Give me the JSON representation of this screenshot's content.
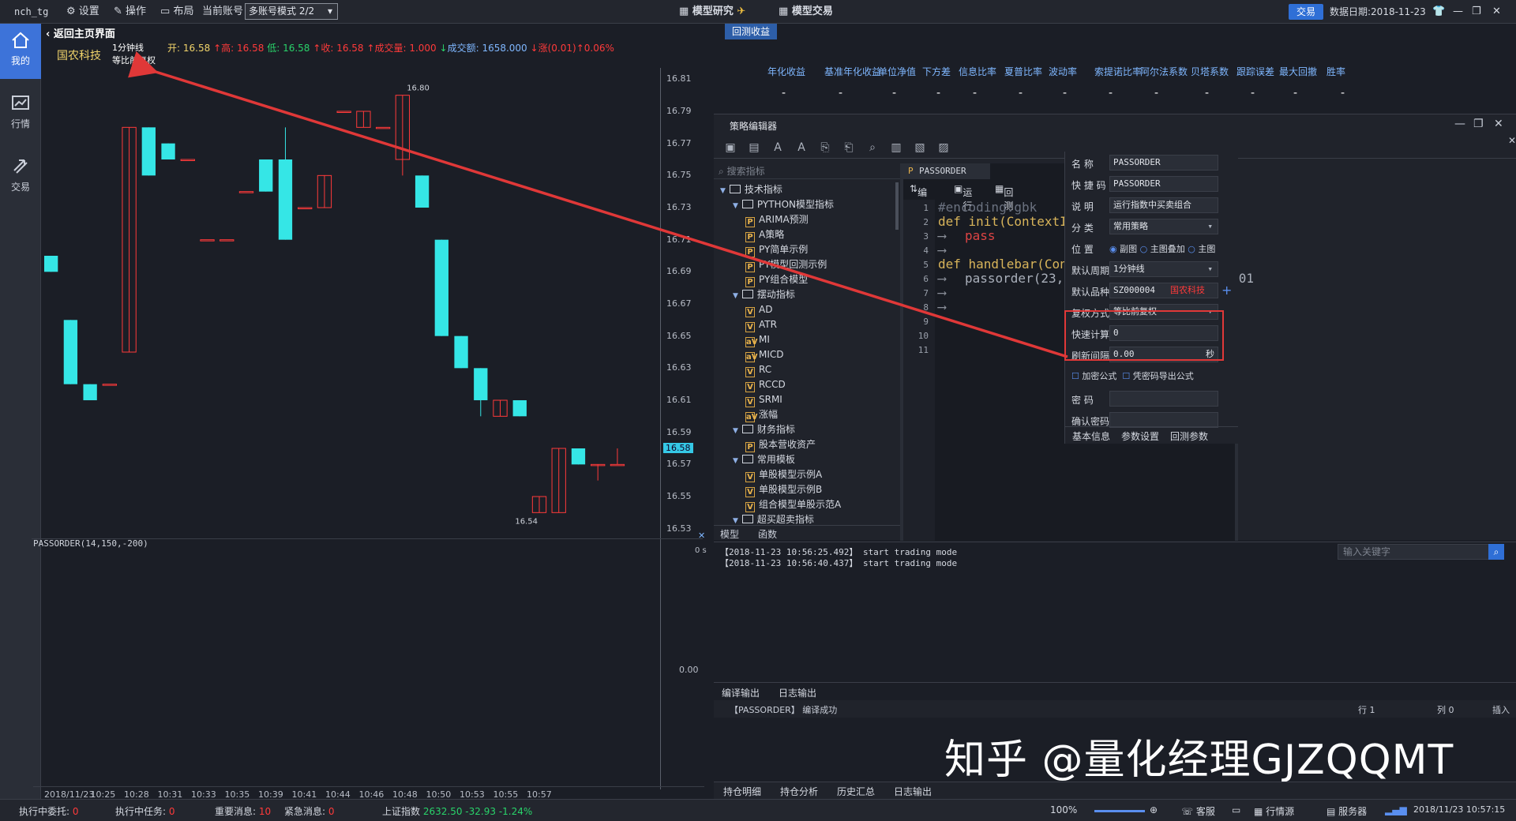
{
  "topbar": {
    "user": "nch_tg",
    "settings": "设置",
    "operate": "操作",
    "layout": "布局",
    "current_account": "当前账号",
    "mode": "多账号模式 2/2",
    "model_research": "模型研究",
    "model_trade": "模型交易",
    "trade": "交易",
    "data_date": "数据日期:2018-11-23"
  },
  "leftnav": {
    "items": [
      {
        "label": "我的"
      },
      {
        "label": "行情"
      },
      {
        "label": "交易"
      }
    ]
  },
  "chart": {
    "back": "返回主页界面",
    "stock": "国农科技",
    "period": "1分钟线",
    "adjust": "等比前复权",
    "quote": {
      "open_label": "开:",
      "open": "16.58",
      "high_label": "高:",
      "high": "16.58",
      "low_label": "低:",
      "low": "16.58",
      "close_label": "收:",
      "close": "16.58",
      "vol_label": "成交量:",
      "vol": "1.000",
      "amt_label": "成交额:",
      "amt": "1658.000",
      "chg_label": "涨(0.01)",
      "chg": "0.06%"
    },
    "high_marker": "16.80",
    "low_marker": "16.54",
    "last_price": "16.58",
    "sub_indicator": "PASSORDER(14,150,-200)",
    "sub_zero": "0.00",
    "sub_right": "0 s"
  },
  "chart_data": {
    "type": "candlestick",
    "yticks": [
      "16.81",
      "16.79",
      "16.77",
      "16.75",
      "16.73",
      "16.71",
      "16.69",
      "16.67",
      "16.65",
      "16.63",
      "16.61",
      "16.59",
      "16.57",
      "16.55",
      "16.53"
    ],
    "xticks": [
      "2018/11/23",
      "10:25",
      "10:28",
      "10:31",
      "10:33",
      "10:35",
      "10:39",
      "10:41",
      "10:44",
      "10:46",
      "10:48",
      "10:50",
      "10:53",
      "10:55",
      "10:57"
    ],
    "candles": [
      {
        "o": 16.7,
        "c": 16.69,
        "h": 16.7,
        "l": 16.69
      },
      {
        "o": 16.66,
        "c": 16.62,
        "h": 16.66,
        "l": 16.62
      },
      {
        "o": 16.62,
        "c": 16.61,
        "h": 16.62,
        "l": 16.61
      },
      {
        "o": 16.62,
        "c": 16.62,
        "h": 16.62,
        "l": 16.62
      },
      {
        "o": 16.64,
        "c": 16.78,
        "h": 16.78,
        "l": 16.64
      },
      {
        "o": 16.78,
        "c": 16.75,
        "h": 16.78,
        "l": 16.75
      },
      {
        "o": 16.77,
        "c": 16.76,
        "h": 16.77,
        "l": 16.76
      },
      {
        "o": 16.76,
        "c": 16.76,
        "h": 16.76,
        "l": 16.76
      },
      {
        "o": 16.71,
        "c": 16.71,
        "h": 16.71,
        "l": 16.71
      },
      {
        "o": 16.71,
        "c": 16.71,
        "h": 16.71,
        "l": 16.71
      },
      {
        "o": 16.74,
        "c": 16.74,
        "h": 16.74,
        "l": 16.74
      },
      {
        "o": 16.76,
        "c": 16.74,
        "h": 16.76,
        "l": 16.74
      },
      {
        "o": 16.76,
        "c": 16.71,
        "h": 16.78,
        "l": 16.71
      },
      {
        "o": 16.73,
        "c": 16.73,
        "h": 16.73,
        "l": 16.73
      },
      {
        "o": 16.73,
        "c": 16.75,
        "h": 16.75,
        "l": 16.73
      },
      {
        "o": 16.79,
        "c": 16.79,
        "h": 16.79,
        "l": 16.79
      },
      {
        "o": 16.78,
        "c": 16.79,
        "h": 16.79,
        "l": 16.78
      },
      {
        "o": 16.78,
        "c": 16.78,
        "h": 16.78,
        "l": 16.78
      },
      {
        "o": 16.76,
        "c": 16.8,
        "h": 16.8,
        "l": 16.75
      },
      {
        "o": 16.75,
        "c": 16.73,
        "h": 16.75,
        "l": 16.73
      },
      {
        "o": 16.71,
        "c": 16.65,
        "h": 16.71,
        "l": 16.65
      },
      {
        "o": 16.65,
        "c": 16.63,
        "h": 16.65,
        "l": 16.63
      },
      {
        "o": 16.63,
        "c": 16.61,
        "h": 16.63,
        "l": 16.6
      },
      {
        "o": 16.6,
        "c": 16.61,
        "h": 16.61,
        "l": 16.6
      },
      {
        "o": 16.61,
        "c": 16.6,
        "h": 16.61,
        "l": 16.6
      },
      {
        "o": 16.54,
        "c": 16.55,
        "h": 16.55,
        "l": 16.54
      },
      {
        "o": 16.54,
        "c": 16.58,
        "h": 16.58,
        "l": 16.54
      },
      {
        "o": 16.58,
        "c": 16.57,
        "h": 16.58,
        "l": 16.57
      },
      {
        "o": 16.57,
        "c": 16.57,
        "h": 16.57,
        "l": 16.56
      },
      {
        "o": 16.57,
        "c": 16.57,
        "h": 16.58,
        "l": 16.57
      }
    ],
    "ylim": [
      16.52,
      16.82
    ]
  },
  "perf": {
    "tab": "回测收益",
    "metrics": [
      "年化收益",
      "基准年化收益",
      "单位净值",
      "下方差",
      "信息比率",
      "夏普比率",
      "波动率",
      "索提诺比率",
      "阿尔法系数",
      "贝塔系数",
      "跟踪误差",
      "最大回撤",
      "胜率"
    ],
    "value": "-"
  },
  "editor": {
    "title": "策略编辑器",
    "search_placeholder": "搜索指标",
    "tree": [
      {
        "t": "folder",
        "label": "技术指标",
        "lvl": 0
      },
      {
        "t": "folder",
        "label": "PYTHON模型指标",
        "lvl": 1
      },
      {
        "t": "P",
        "label": "ARIMA预测",
        "lvl": 2
      },
      {
        "t": "P",
        "label": "A策略",
        "lvl": 2
      },
      {
        "t": "P",
        "label": "PY简单示例",
        "lvl": 2
      },
      {
        "t": "P",
        "label": "PY模型回测示例",
        "lvl": 2
      },
      {
        "t": "P",
        "label": "PY组合模型",
        "lvl": 2
      },
      {
        "t": "folder",
        "label": "摆动指标",
        "lvl": 1
      },
      {
        "t": "V",
        "label": "AD",
        "lvl": 2
      },
      {
        "t": "V",
        "label": "ATR",
        "lvl": 2
      },
      {
        "t": "aV",
        "label": "MI",
        "lvl": 2
      },
      {
        "t": "aV",
        "label": "MICD",
        "lvl": 2
      },
      {
        "t": "V",
        "label": "RC",
        "lvl": 2
      },
      {
        "t": "V",
        "label": "RCCD",
        "lvl": 2
      },
      {
        "t": "V",
        "label": "SRMI",
        "lvl": 2
      },
      {
        "t": "aV",
        "label": "涨幅",
        "lvl": 2
      },
      {
        "t": "folder",
        "label": "财务指标",
        "lvl": 1
      },
      {
        "t": "P",
        "label": "股本营收资产",
        "lvl": 2
      },
      {
        "t": "folder",
        "label": "常用模板",
        "lvl": 1
      },
      {
        "t": "V",
        "label": "单股模型示例A",
        "lvl": 2
      },
      {
        "t": "V",
        "label": "单股模型示例B",
        "lvl": 2
      },
      {
        "t": "V",
        "label": "组合模型单股示范A",
        "lvl": 2
      },
      {
        "t": "folder",
        "label": "超买超卖指标",
        "lvl": 1
      }
    ],
    "tree_tabs": [
      "模型",
      "函数"
    ],
    "file_tab": "PASSORDER",
    "compile": "编译",
    "run": "运行",
    "backtest": "回测",
    "code": [
      "#encoding:gbk",
      "def init(ContextInfo):",
      "pass",
      "",
      "def handlebar(ContextInfo):",
      "passorder(23,1101,'6000000024','000001",
      "",
      "",
      "",
      "",
      ""
    ]
  },
  "props": {
    "name_label": "名  称",
    "name": "PASSORDER",
    "short_label": "快 捷 码",
    "short": "PASSORDER",
    "desc_label": "说  明",
    "desc": "运行指数中买卖组合",
    "cat_label": "分  类",
    "cat": "常用策略",
    "pos_label": "位  置",
    "pos_options": [
      "副图",
      "主图叠加",
      "主图"
    ],
    "period_label": "默认周期",
    "period": "1分钟线",
    "symbol_label": "默认品种",
    "symbol": "SZ000004",
    "symbol_name": "国农科技",
    "adjust_label": "复权方式",
    "adjust": "等比前复权",
    "fast_label": "快速计算",
    "fast": "0",
    "refresh_label": "刷新间隔",
    "refresh": "0.00",
    "refresh_unit": "秒",
    "encrypt": "加密公式",
    "export": "凭密码导出公式",
    "pwd_label": "密  码",
    "pwd2_label": "确认密码",
    "tabs": [
      "基本信息",
      "参数设置",
      "回测参数"
    ]
  },
  "log": {
    "lines": [
      "【2018-11-23 10:56:25.492】 start trading mode",
      "【2018-11-23 10:56:40.437】 start trading mode"
    ],
    "search_placeholder": "输入关键字",
    "tabs": [
      "编译输出",
      "日志输出"
    ],
    "compile_msg": "【PASSORDER】 编译成功",
    "row": "行 1",
    "col": "列 0",
    "insert": "插入"
  },
  "watermark": "知乎 @量化经理GJZQQMT",
  "bottom_tabs": [
    "持仓明细",
    "持仓分析",
    "历史汇总",
    "日志输出"
  ],
  "status": {
    "entrusting_label": "执行中委托:",
    "entrusting": "0",
    "tasks_label": "执行中任务:",
    "tasks": "0",
    "important_label": "重要消息:",
    "important": "10",
    "urgent_label": "紧急消息:",
    "urgent": "0",
    "index_label": "上证指数",
    "index_val": "2632.50",
    "index_chg": "-32.93",
    "index_pct": "-1.24%",
    "zoom": "100%",
    "service": "客服",
    "quote_source": "行情源",
    "server": "服务器",
    "time": "2018/11/23 10:57:15"
  },
  "colors": {
    "up": "#ff3a3a",
    "down": "#35e6e6",
    "accent": "#2f6fd6"
  }
}
